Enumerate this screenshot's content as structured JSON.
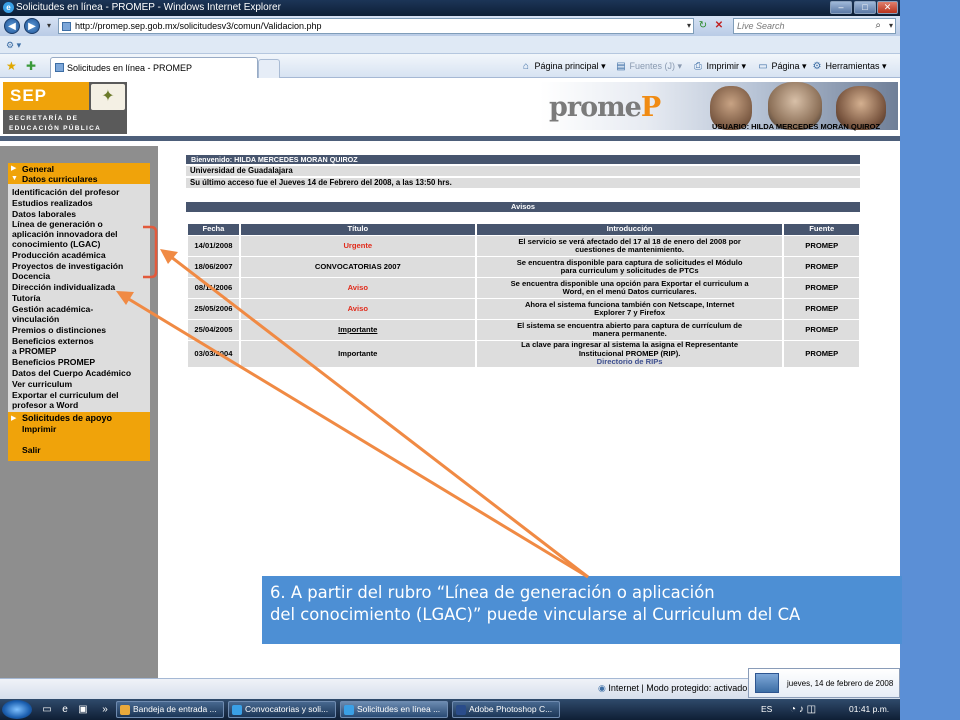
{
  "window": {
    "title": "Solicitudes en línea - PROMEP - Windows Internet Explorer"
  },
  "address": {
    "url": "http://promep.sep.gob.mx/solicitudesv3/comun/Validacion.php",
    "search_placeholder": "Live Search"
  },
  "tab": {
    "title": "Solicitudes en línea - PROMEP"
  },
  "commands": {
    "home": "Página principal",
    "feeds": "Fuentes (J)",
    "print": "Imprimir",
    "page": "Página",
    "tools": "Herramientas"
  },
  "header": {
    "sep_logo": "SEP",
    "sep_line1": "SECRETARÍA DE",
    "sep_line2": "EDUCACIÓN PÚBLICA",
    "brand": "promeP",
    "user_line": "USUARIO: HILDA MERCEDES MORAN QUIROZ"
  },
  "sidebar": {
    "general": "General",
    "datos_curriculares": "Datos curriculares",
    "items": [
      "Identificación del profesor",
      "Estudios realizados",
      "Datos laborales",
      "Línea de generación o",
      "aplicación innovadora del",
      "conocimiento (LGAC)",
      "Producción académica",
      "Proyectos de investigación",
      "Docencia",
      "Dirección individualizada",
      "Tutoría",
      "Gestión académica-",
      "vinculación",
      "Premios o distinciones",
      "Beneficios externos",
      "a PROMEP",
      "Beneficios PROMEP",
      "Datos del Cuerpo Académico",
      "Ver curriculum",
      "Exportar el curriculum del",
      "profesor a Word"
    ],
    "solicitudes": "Solicitudes de apoyo",
    "imprimir": "Imprimir",
    "salir": "Salir"
  },
  "info": {
    "welcome": "Bienvenido: HILDA MERCEDES MORAN QUIROZ",
    "university": "Universidad de Guadalajara",
    "last_access": "Su último acceso fue el Jueves 14 de Febrero del 2008, a las 13:50 hrs."
  },
  "avisos": {
    "title": "Avisos",
    "columns": [
      "Fecha",
      "Título",
      "Introducción",
      "Fuente"
    ],
    "rows": [
      {
        "fecha": "14/01/2008",
        "titulo": "Urgente",
        "intro1": "El servicio se verá afectado del 17 al 18 de enero del 2008 por",
        "intro2": "cuestiones de mantenimiento.",
        "intro3": "",
        "fuente": "PROMEP",
        "color": "#e12b1b"
      },
      {
        "fecha": "18/06/2007",
        "titulo": "CONVOCATORIAS 2007",
        "intro1": "Se encuentra disponible para captura de solicitudes el Módulo",
        "intro2": "para curriculum y solicitudes de PTCs",
        "intro3": "",
        "fuente": "PROMEP",
        "color": "#000000"
      },
      {
        "fecha": "08/11/2006",
        "titulo": "Aviso",
        "intro1": "Se encuentra disponible una opción para Exportar el curriculum a",
        "intro2": "Word, en el menú Datos curriculares.",
        "intro3": "",
        "fuente": "PROMEP",
        "color": "#e12b1b"
      },
      {
        "fecha": "25/05/2006",
        "titulo": "Aviso",
        "intro1": "Ahora el sistema funciona también con Netscape, Internet",
        "intro2": "Explorer 7 y Firefox",
        "intro3": "",
        "fuente": "PROMEP",
        "color": "#e12b1b"
      },
      {
        "fecha": "25/04/2005",
        "titulo": "Importante",
        "intro1": "El sistema se encuentra abierto para captura de currículum de",
        "intro2": "manera permanente.",
        "intro3": "",
        "fuente": "PROMEP",
        "color": "#000000"
      },
      {
        "fecha": "03/03/2004",
        "titulo": "Importante",
        "intro1": "La clave para ingresar al sistema la asigna el Representante",
        "intro2": "Institucional PROMEP (RIP).",
        "intro3": "Directorio de RIPs",
        "fuente": "PROMEP",
        "color": "#000000"
      }
    ]
  },
  "status": {
    "zone": "Internet | Modo protegido: activado"
  },
  "date_popup": "jueves, 14 de febrero de 2008",
  "taskbar": {
    "tasks": [
      "Bandeja de entrada ...",
      "Convocatorias y soli...",
      "Solicitudes en línea ...",
      "Adobe Photoshop C..."
    ],
    "lang": "ES",
    "clock": "01:41 p.m."
  },
  "callout": {
    "line1": "6. A partir del rubro “Línea de generación o aplicación",
    "line2": "del conocimiento (LGAC)” puede vincularse al Curriculum del CA"
  },
  "colors": {
    "accent_orange": "#f0a30a",
    "callout_blue": "#4d8fd4",
    "arrow_orange": "#f08a44",
    "header_navy": "#47556e",
    "urgent_red": "#e12b1b"
  }
}
